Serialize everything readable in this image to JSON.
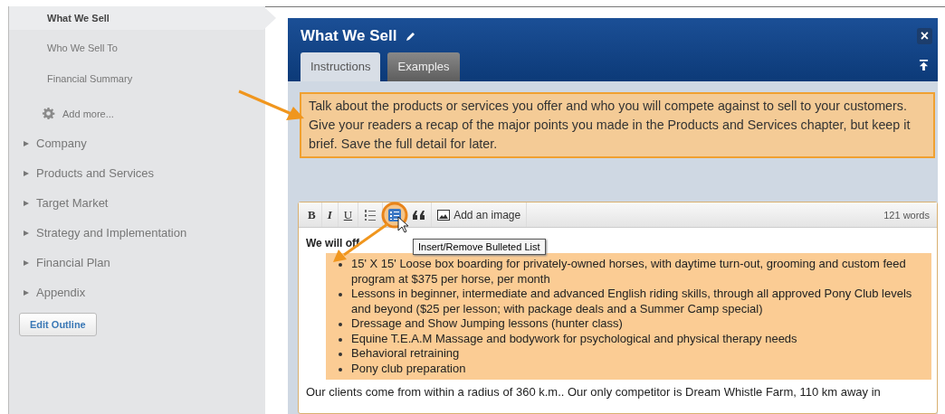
{
  "sidebar": {
    "sub_items": [
      {
        "label": "What We Sell",
        "selected": true
      },
      {
        "label": "Who We Sell To",
        "selected": false
      },
      {
        "label": "Financial Summary",
        "selected": false
      }
    ],
    "add_more": "Add more...",
    "chapters": [
      {
        "label": "Company",
        "expanded": false
      },
      {
        "label": "Products and Services",
        "expanded": false
      },
      {
        "label": "Target Market",
        "expanded": false
      },
      {
        "label": "Strategy and Implementation",
        "expanded": false
      },
      {
        "label": "Financial Plan",
        "expanded": false
      },
      {
        "label": "Appendix",
        "expanded": false
      }
    ],
    "edit_button": "Edit Outline"
  },
  "dialog": {
    "title": "What We Sell",
    "close": "×",
    "tabs": [
      {
        "label": "Instructions",
        "selected": true
      },
      {
        "label": "Examples",
        "selected": false
      }
    ],
    "instructions": "Talk about the products or services you offer and who you will compete against to sell to your customers. Give your readers a recap of the major points you made in the Products and Services chapter, but keep it brief. Save the full detail for later.",
    "editor": {
      "toolbar": [
        {
          "kind": "bold",
          "label": "B"
        },
        {
          "kind": "italic",
          "label": "I"
        },
        {
          "kind": "underline",
          "label": "U"
        },
        {
          "kind": "numbered"
        },
        {
          "kind": "bulleted",
          "highlighted": true
        },
        {
          "kind": "quote"
        },
        {
          "kind": "image",
          "label": "Add an image"
        }
      ],
      "word_count": "121 words",
      "tooltip": "Insert/Remove Bulleted List",
      "intro": "We will off",
      "bullets": [
        "15' X 15' Loose box boarding for privately-owned horses, with daytime turn-out, grooming and custom feed program at $375 per horse, per month",
        "Lessons in beginner, intermediate and advanced English riding skills, through all approved Pony Club levels and beyond ($25 per lesson; with package deals and a Summer Camp special)",
        "Dressage and Show Jumping lessons (hunter class)",
        "Equine T.E.A.M Massage and bodywork for psychological and physical therapy needs",
        "Behavioral retraining",
        "Pony club preparation"
      ],
      "bullets_selected": true,
      "closing": "Our clients come from within a radius of 360 k.m.. Our only competitor is Dream Whistle Farm, 110 km away in"
    }
  }
}
